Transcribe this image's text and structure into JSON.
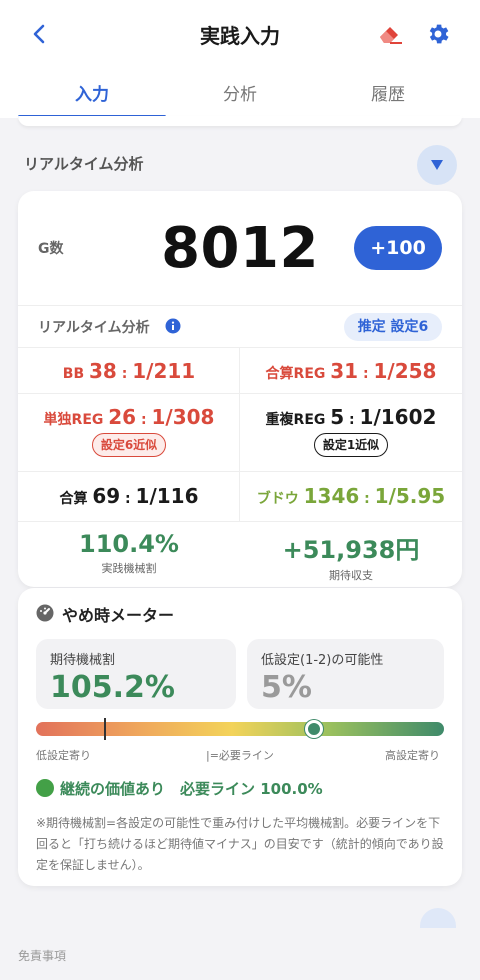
{
  "header": {
    "title": "実践入力",
    "tabs": [
      {
        "label": "入力",
        "active": true
      },
      {
        "label": "分析",
        "active": false
      },
      {
        "label": "履歴",
        "active": false
      }
    ]
  },
  "section": {
    "title": "リアルタイム分析"
  },
  "counter": {
    "label": "G数",
    "value": "8012",
    "add_label": "+100"
  },
  "realtime": {
    "label": "リアルタイム分析",
    "estimate": "推定 設定6",
    "bb": {
      "name": "BB",
      "count": "38",
      "rate": "1/211"
    },
    "total_reg": {
      "name": "合算REG",
      "count": "31",
      "rate": "1/258"
    },
    "solo_reg": {
      "name": "単独REG",
      "count": "26",
      "rate": "1/308",
      "badge": "設定6近似"
    },
    "cherry_reg": {
      "name": "重複REG",
      "count": "5",
      "rate": "1/1602",
      "badge": "設定1近似"
    },
    "total": {
      "name": "合算",
      "count": "69",
      "rate": "1/116"
    },
    "grape": {
      "name": "ブドウ",
      "count": "1346",
      "rate": "1/5.95"
    },
    "payout": {
      "value": "110.4%",
      "caption": "実践機械割"
    },
    "expected": {
      "value": "+51,938円",
      "caption": "期待収支"
    }
  },
  "meter": {
    "title": "やめ時メーター",
    "expected_rate": {
      "label": "期待機械割",
      "value": "105.2%"
    },
    "low_setting": {
      "label": "低設定(1-2)の可能性",
      "value": "5%"
    },
    "gauge_position": 0.68,
    "required_line": 0.17,
    "scale": {
      "left": "低設定寄り",
      "center": "|=必要ライン",
      "right": "高設定寄り"
    },
    "status": "継続の価値あり　必要ライン 100.0%",
    "note": "※期待機械割=各設定の可能性で重み付けした平均機械割。必要ラインを下回ると「打ち続けるほど期待値マイナス」の目安です（統計的傾向であり設定を保証しません）。"
  },
  "footer": {
    "disclaimer": "免責事項"
  },
  "colors": {
    "accent": "#2f63d6",
    "red": "#d94a3c",
    "green": "#3c8a5a",
    "grape": "#7aa63a"
  }
}
